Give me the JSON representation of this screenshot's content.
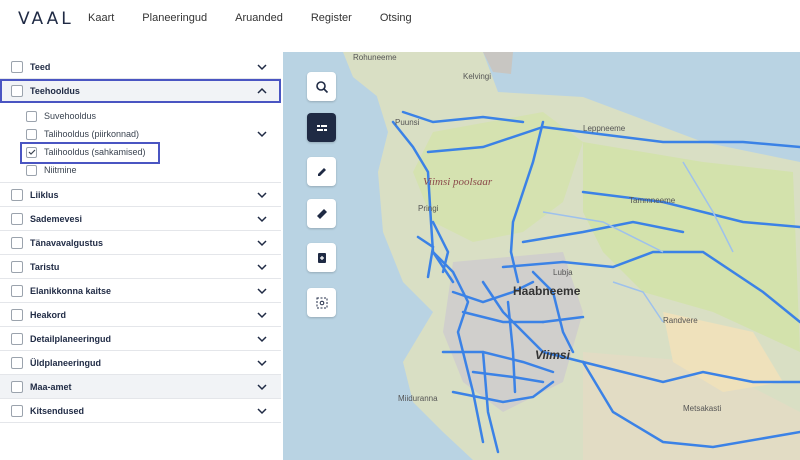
{
  "app": {
    "logo": "VAAL"
  },
  "nav": [
    "Kaart",
    "Planeeringud",
    "Aruanded",
    "Register",
    "Otsing"
  ],
  "layers": [
    {
      "label": "Teed"
    },
    {
      "label": "Teehooldus"
    },
    {
      "label": "Liiklus"
    },
    {
      "label": "Sademevesi"
    },
    {
      "label": "Tänavavalgustus"
    },
    {
      "label": "Taristu"
    },
    {
      "label": "Elanikkonna kaitse"
    },
    {
      "label": "Heakord"
    },
    {
      "label": "Detailplaneeringud"
    },
    {
      "label": "Üldplaneeringud"
    },
    {
      "label": "Maa-amet"
    },
    {
      "label": "Kitsendused"
    }
  ],
  "sublayers": [
    {
      "label": "Suvehooldus"
    },
    {
      "label": "Talihooldus (piirkonnad)"
    },
    {
      "label": "Talihooldus (sahkamised)"
    },
    {
      "label": "Niitmine"
    }
  ],
  "map_labels": {
    "rohuneeme": "Rohuneeme",
    "kelvingi": "Kelvingi",
    "puunsi": "Puunsi",
    "leppneeme": "Leppneeme",
    "viimsi_poolsaar": "Viimsi poolsaar",
    "tammneeme": "Tammneeme",
    "pringi": "Pringi",
    "lubja": "Lubja",
    "haabneeme": "Haabneeme",
    "randvere": "Randvere",
    "viimsi": "Viimsi",
    "miiduranna": "Miiduranna",
    "metsakasti": "Metsakasti"
  },
  "tools": [
    "search-icon",
    "layers-icon",
    "pencil-icon",
    "ruler-icon",
    "document-icon",
    "select-area-icon"
  ],
  "colors": {
    "accent": "#4a55c2",
    "road": "#3b82e6",
    "land": "#dfe6c8",
    "water": "#b9d3e3"
  }
}
